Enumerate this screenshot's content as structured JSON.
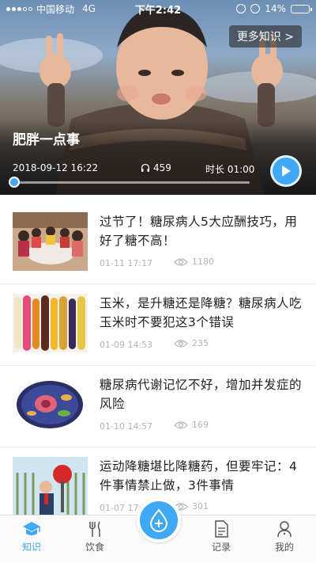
{
  "status_bar": {
    "carrier": "中国移动",
    "network": "4G",
    "time": "下午2:42",
    "battery": "14%",
    "battery_level": 0.14
  },
  "hero": {
    "more_label": "更多知识 >",
    "title": "肥胖一点事",
    "date": "2018-09-12 16:22",
    "listens": "459",
    "duration": "时长 01:00",
    "progress": 0.0,
    "accent": "#3fa9f5"
  },
  "articles": [
    {
      "title": "过节了！糖尿病人5大应酬技巧，用好了糖不高！",
      "date": "01-11 17:17",
      "views": "1180",
      "thumb": "dinner-party-photo"
    },
    {
      "title": "玉米，是升糖还是降糖？糖尿病人吃玉米时不要犯这3个错误",
      "date": "01-09 14:53",
      "views": "235",
      "thumb": "corn-photo"
    },
    {
      "title": "糖尿病代谢记忆不好，增加并发症的风险",
      "date": "01-10 14:57",
      "views": "169",
      "thumb": "cell-illustration"
    },
    {
      "title": "运动降糖堪比降糖药，但要牢记：4件事情禁止做，3件事情",
      "date": "01-07 17:21",
      "views": "301",
      "thumb": "stop-sign-illustration"
    }
  ],
  "tabbar": {
    "tabs": [
      {
        "label": "知识",
        "icon": "graduation-cap-icon",
        "active": true
      },
      {
        "label": "饮食",
        "icon": "fork-knife-icon",
        "active": false
      },
      {
        "label": "",
        "icon": "drop-plus-icon",
        "active": false
      },
      {
        "label": "记录",
        "icon": "document-icon",
        "active": false
      },
      {
        "label": "我的",
        "icon": "person-icon",
        "active": false
      }
    ],
    "active_color": "#3fa9f5",
    "inactive_color": "#555555"
  }
}
